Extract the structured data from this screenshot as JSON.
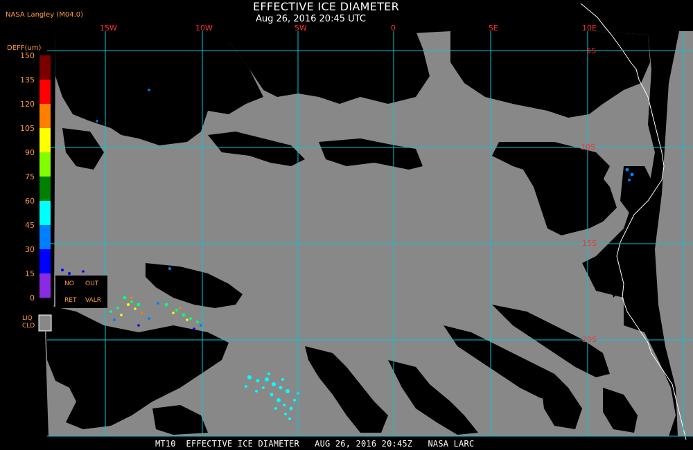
{
  "title": "EFFECTIVE ICE DIAMETER",
  "subtitle": "Aug 26, 2016 20:45 UTC",
  "credit": "NASA Langley (M04.0)",
  "footer": "MT10  EFFECTIVE ICE DIAMETER   AUG 26, 2016 20:45Z   NASA LARC",
  "legend": {
    "title": "DEFF(um)",
    "ticks": [
      "150",
      "135",
      "120",
      "105",
      "90",
      "75",
      "60",
      "45",
      "30",
      "15",
      "0"
    ],
    "colors": [
      "#7a0000",
      "#ff0000",
      "#ff7f00",
      "#ffff00",
      "#80ff00",
      "#008000",
      "#00ffff",
      "#0080ff",
      "#0000ff",
      "#8a2be2"
    ],
    "no_ret_labels": [
      "NO",
      "RET"
    ],
    "out_valr_labels": [
      "OUT",
      "VALR"
    ],
    "liq_cld_labels": [
      "LIQ",
      "CLD"
    ],
    "liq_cld_color": "#888888"
  },
  "graticule": {
    "lon_labels": [
      "15W",
      "10W",
      "5W",
      "0",
      "5E",
      "10E"
    ],
    "lat_labels": [
      "5S",
      "10S",
      "15S",
      "20S"
    ],
    "line_color": "#00c8d8",
    "label_color": "#ff3030"
  },
  "colors": {
    "background": "#000000",
    "liquid_cloud": "#888888",
    "coast": "#ffffff"
  }
}
